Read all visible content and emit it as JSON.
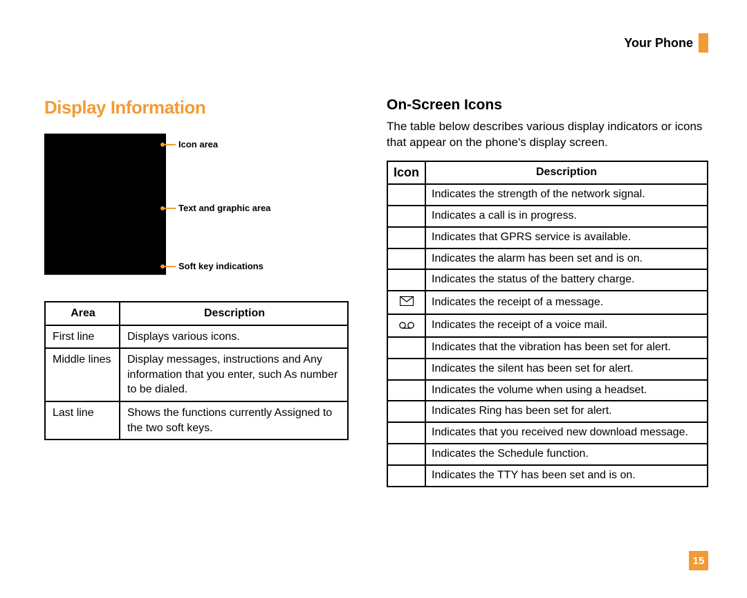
{
  "header": {
    "section_label": "Your Phone"
  },
  "page_number": "15",
  "left": {
    "heading": "Display Information",
    "callouts": {
      "icon_area": "Icon area",
      "text_graphic": "Text and graphic area",
      "softkeys": "Soft key indications"
    },
    "table": {
      "cols": {
        "area": "Area",
        "desc": "Description"
      },
      "rows": [
        {
          "area": "First line",
          "desc": "Displays various icons."
        },
        {
          "area": "Middle lines",
          "desc": "Display messages, instructions and Any information that you enter, such As number to be dialed."
        },
        {
          "area": "Last line",
          "desc": "Shows the functions currently Assigned to the two soft keys."
        }
      ]
    }
  },
  "right": {
    "heading": "On-Screen Icons",
    "intro": "The table below describes various display indicators or icons that appear on the phone's display screen.",
    "table": {
      "cols": {
        "icon": "Icon",
        "desc": "Description"
      },
      "rows": [
        {
          "icon": "",
          "desc": "Indicates the strength of the network signal."
        },
        {
          "icon": "",
          "desc": "Indicates a call is in progress."
        },
        {
          "icon": "",
          "desc": "Indicates that GPRS service is available."
        },
        {
          "icon": "",
          "desc": "Indicates the alarm has been set and is on."
        },
        {
          "icon": "",
          "desc": "Indicates the status of the battery charge."
        },
        {
          "icon": "envelope",
          "desc": "Indicates the receipt of a message."
        },
        {
          "icon": "voicemail",
          "desc": "Indicates the receipt of a voice mail."
        },
        {
          "icon": "",
          "desc": "Indicates that the vibration has been set for alert."
        },
        {
          "icon": "",
          "desc": "Indicates the silent has been set for alert."
        },
        {
          "icon": "",
          "desc": "Indicates the volume when using a headset."
        },
        {
          "icon": "",
          "desc": "Indicates Ring has been set for alert."
        },
        {
          "icon": "",
          "desc": "Indicates that you received new download message."
        },
        {
          "icon": "",
          "desc": "Indicates the Schedule function."
        },
        {
          "icon": "",
          "desc": "Indicates the TTY has been set and is on."
        }
      ]
    }
  }
}
